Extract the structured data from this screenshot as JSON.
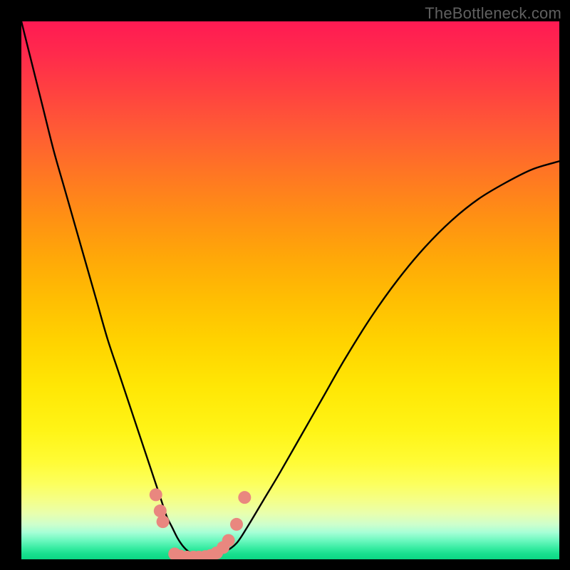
{
  "watermark": "TheBottleneck.com",
  "chart_data": {
    "type": "line",
    "title": "",
    "xlabel": "",
    "ylabel": "",
    "xlim": [
      0,
      100
    ],
    "ylim": [
      0,
      100
    ],
    "gradient_stops": [
      {
        "pct": 0,
        "color": "#ff1a53"
      },
      {
        "pct": 6,
        "color": "#ff2a4c"
      },
      {
        "pct": 12,
        "color": "#ff3e42"
      },
      {
        "pct": 20,
        "color": "#ff5a35"
      },
      {
        "pct": 28,
        "color": "#ff7524"
      },
      {
        "pct": 36,
        "color": "#ff8f14"
      },
      {
        "pct": 44,
        "color": "#ffa808"
      },
      {
        "pct": 52,
        "color": "#ffbf02"
      },
      {
        "pct": 60,
        "color": "#ffd400"
      },
      {
        "pct": 68,
        "color": "#ffe705"
      },
      {
        "pct": 76,
        "color": "#fff416"
      },
      {
        "pct": 82,
        "color": "#fffc36"
      },
      {
        "pct": 86,
        "color": "#fcff5e"
      },
      {
        "pct": 89,
        "color": "#f5ff88"
      },
      {
        "pct": 91.5,
        "color": "#e8ffae"
      },
      {
        "pct": 93.5,
        "color": "#ceffcc"
      },
      {
        "pct": 95,
        "color": "#a6ffd6"
      },
      {
        "pct": 96.5,
        "color": "#6cf8bf"
      },
      {
        "pct": 98,
        "color": "#34eba0"
      },
      {
        "pct": 99,
        "color": "#18df8e"
      },
      {
        "pct": 100,
        "color": "#0cd784"
      }
    ],
    "series": [
      {
        "name": "bottleneck-curve",
        "x": [
          0,
          2,
          4,
          6,
          8,
          10,
          12,
          14,
          16,
          18,
          20,
          22,
          24,
          26,
          27,
          28,
          29,
          30,
          31,
          32,
          33,
          34,
          35,
          36,
          38,
          40,
          42,
          45,
          48,
          52,
          56,
          60,
          65,
          70,
          75,
          80,
          85,
          90,
          95,
          100
        ],
        "y": [
          100,
          92,
          84,
          76,
          69,
          62,
          55,
          48,
          41,
          35,
          29,
          23,
          17,
          11,
          8,
          6,
          4,
          2.5,
          1.5,
          1,
          0.7,
          0.5,
          0.5,
          0.7,
          1.5,
          3,
          6,
          11,
          16,
          23,
          30,
          37,
          45,
          52,
          58,
          63,
          67,
          70,
          72.5,
          74
        ]
      }
    ],
    "markers": [
      {
        "x": 25.0,
        "y": 12.0
      },
      {
        "x": 25.8,
        "y": 9.0
      },
      {
        "x": 26.3,
        "y": 7.0
      },
      {
        "x": 28.5,
        "y": 1.0
      },
      {
        "x": 29.5,
        "y": 0.6
      },
      {
        "x": 30.8,
        "y": 0.4
      },
      {
        "x": 32.0,
        "y": 0.4
      },
      {
        "x": 33.0,
        "y": 0.4
      },
      {
        "x": 34.2,
        "y": 0.5
      },
      {
        "x": 35.2,
        "y": 0.7
      },
      {
        "x": 36.3,
        "y": 1.2
      },
      {
        "x": 37.5,
        "y": 2.2
      },
      {
        "x": 38.5,
        "y": 3.5
      },
      {
        "x": 40.0,
        "y": 6.5
      },
      {
        "x": 41.5,
        "y": 11.5
      }
    ],
    "marker_color": "#e9877f",
    "curve_color": "#000000"
  }
}
